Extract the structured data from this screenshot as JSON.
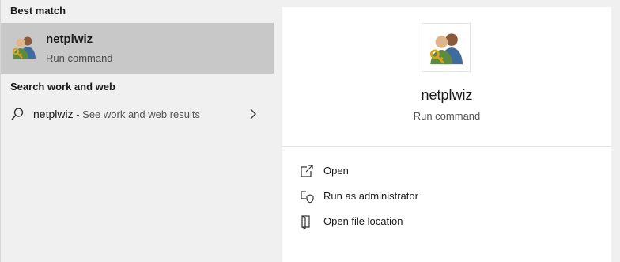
{
  "left_panel": {
    "best_match_heading": "Best match",
    "best_match": {
      "name": "netplwiz",
      "subtitle": "Run command",
      "icon": "user-accounts-icon"
    },
    "web_heading": "Search work and web",
    "web_result": {
      "query": "netplwiz",
      "suffix": " - See work and web results",
      "icon": "search-icon"
    }
  },
  "detail_panel": {
    "app_name": "netplwiz",
    "app_subtitle": "Run command",
    "icon": "user-accounts-icon",
    "actions": [
      {
        "label": "Open",
        "icon": "open-icon"
      },
      {
        "label": "Run as administrator",
        "icon": "run-as-admin-icon"
      },
      {
        "label": "Open file location",
        "icon": "file-location-icon"
      }
    ]
  },
  "colors": {
    "selected_bg": "#c8c8c8",
    "panel_bg": "#ffffff",
    "left_bg": "#f0f0f0"
  }
}
